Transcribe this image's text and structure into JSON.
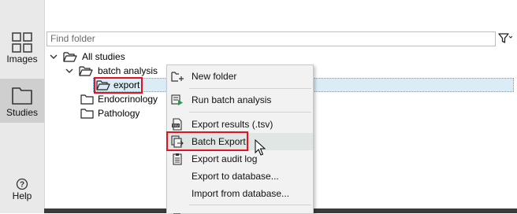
{
  "rail": {
    "items": [
      {
        "label": "Images",
        "icon": "grid-icon"
      },
      {
        "label": "Studies",
        "icon": "folder-icon",
        "active": true
      },
      {
        "label": "Help",
        "icon": "help-circle-icon"
      }
    ]
  },
  "search": {
    "placeholder": "Find folder",
    "value": ""
  },
  "tree": {
    "items": [
      {
        "label": "All studies",
        "expanded": true
      },
      {
        "label": "batch analysis",
        "expanded": true
      },
      {
        "label": "export",
        "selected": true
      },
      {
        "label": "Endocrinology"
      },
      {
        "label": "Pathology"
      }
    ]
  },
  "context_menu": {
    "items": [
      {
        "label": "New folder",
        "icon": "new-folder-icon"
      },
      {
        "label": "Run batch analysis",
        "icon": "run-batch-icon"
      },
      {
        "label": "Export results (.tsv)",
        "icon": "export-tsv-icon"
      },
      {
        "label": "Batch Export",
        "icon": "batch-export-icon",
        "hovered": true
      },
      {
        "label": "Export audit log",
        "icon": "audit-log-icon"
      },
      {
        "label": "Export to database...",
        "icon": ""
      },
      {
        "label": "Import from database...",
        "icon": ""
      }
    ]
  },
  "colors": {
    "highlight_red": "#e0141e",
    "selection_bg": "#dcecf7",
    "menu_hover": "#dfe6e4",
    "rail_bg": "#e9e9e9"
  }
}
